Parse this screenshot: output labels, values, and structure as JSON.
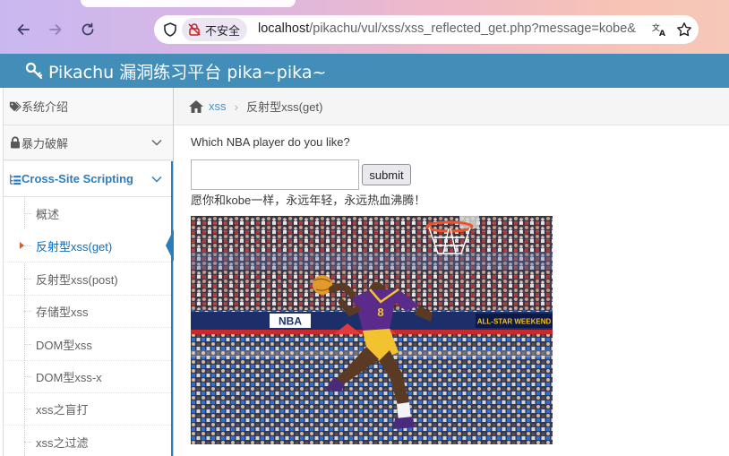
{
  "browser": {
    "security_label": "不安全",
    "url_host": "localhost",
    "url_path": "/pikachu/vul/xss/xss_reflected_get.php?message=kobe&"
  },
  "header": {
    "title": "Pikachu 漏洞练习平台 pika~pika~"
  },
  "sidebar": {
    "items": [
      {
        "label": "系统介绍"
      },
      {
        "label": "暴力破解"
      },
      {
        "label": "Cross-Site Scripting"
      }
    ],
    "sub_items": [
      {
        "label": "概述"
      },
      {
        "label": "反射型xss(get)"
      },
      {
        "label": "反射型xss(post)"
      },
      {
        "label": "存储型xss"
      },
      {
        "label": "DOM型xss"
      },
      {
        "label": "DOM型xss-x"
      },
      {
        "label": "xss之盲打"
      },
      {
        "label": "xss之过滤"
      }
    ]
  },
  "breadcrumb": {
    "section": "xss",
    "current": "反射型xss(get)"
  },
  "main": {
    "question": "Which NBA player do you like?",
    "input_value": "",
    "submit_label": "submit",
    "result_message": "愿你和kobe一样，永远年轻，永远热血沸腾！"
  },
  "photo": {
    "banner_nba": "NBA",
    "banner_allstar": "ALL-STAR WEEKEND",
    "jersey_number": "8"
  },
  "colors": {
    "header_bg": "#438eb9",
    "active_blue": "#2b7dbc",
    "jersey_purple": "#5b2b8c",
    "jersey_gold": "#f2c230"
  }
}
